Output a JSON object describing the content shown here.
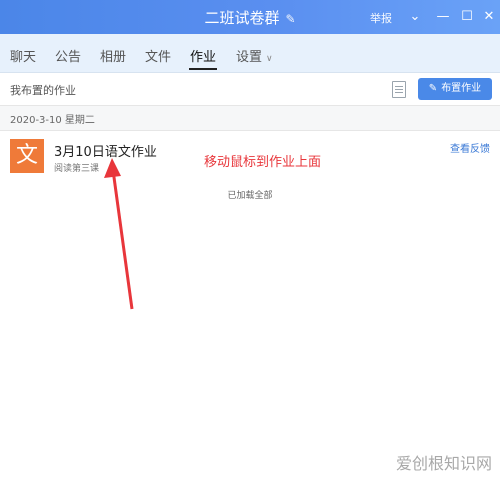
{
  "window": {
    "title": "二班试卷群",
    "report": "举报",
    "controls": [
      "chevron-down-icon",
      "minimize-icon",
      "maximize-icon",
      "close-icon"
    ]
  },
  "tabs": [
    {
      "label": "聊天"
    },
    {
      "label": "公告"
    },
    {
      "label": "相册"
    },
    {
      "label": "文件"
    },
    {
      "label": "作业",
      "active": true
    },
    {
      "label": "设置"
    }
  ],
  "right_buttons": [
    "phone-icon",
    "video-icon",
    "classroom-icon",
    "add-app-icon",
    "more-icon"
  ],
  "subheader": {
    "label": "我布置的作业",
    "assign_button": "布置作业"
  },
  "date_row": "2020-3-10 星期二",
  "homework_item": {
    "avatar": "文",
    "title": "3月10日语文作业",
    "subtitle": "阅读第三课",
    "feedback_link": "查看反馈"
  },
  "loaded_all": "已加载全部",
  "annotation": "移动鼠标到作业上面",
  "watermark": "爱创根知识网",
  "colors": {
    "primary": "#4a89e8",
    "accent": "#ef7a39",
    "annotation": "#e8363b"
  }
}
